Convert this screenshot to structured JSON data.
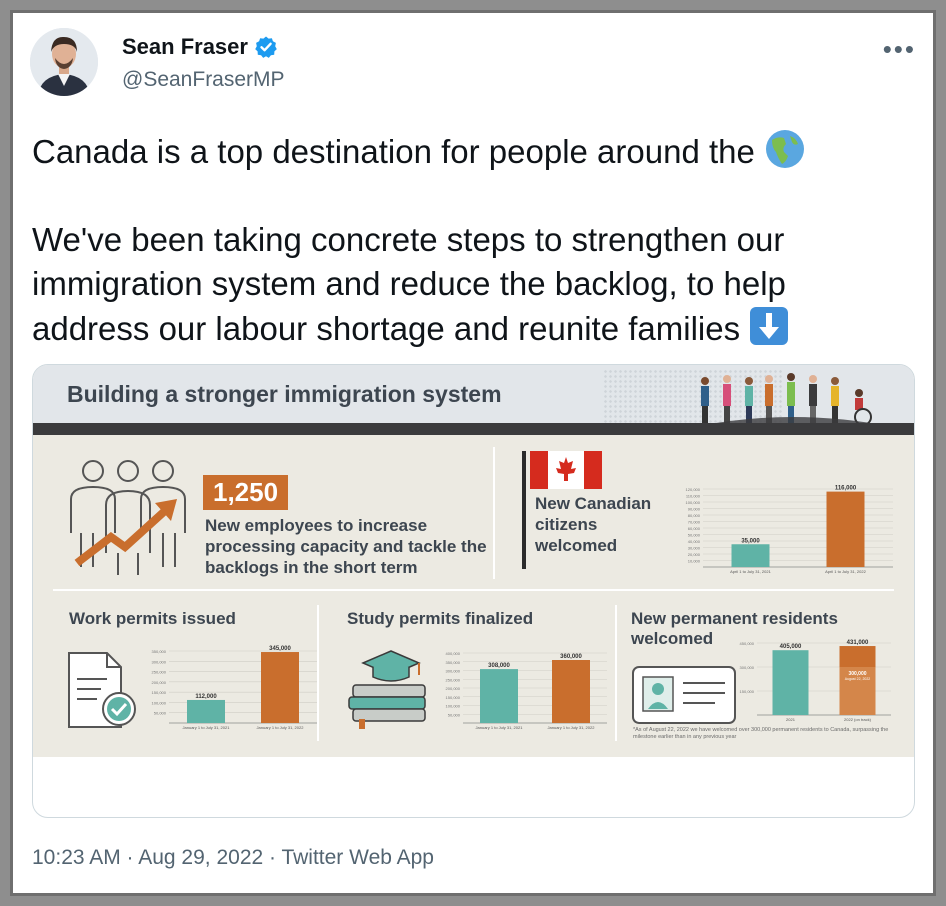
{
  "tweet": {
    "author_name": "Sean Fraser",
    "handle": "@SeanFraserMP",
    "more_label": "•••",
    "line1": "Canada is a top destination for people around the",
    "line2": "We've been taking concrete steps to strengthen our",
    "line3": "immigration system and reduce the backlog, to help",
    "line4": "address our labour shortage and reunite families",
    "timestamp": "10:23 AM · Aug 29, 2022 · Twitter Web App"
  },
  "infographic": {
    "title": "Building a stronger immigration system",
    "employees_number": "1,250",
    "employees_bold": "New employees",
    "employees_text": " to increase processing capacity and tackle the backlogs in the short term",
    "citizens_text": "New Canadian citizens welcomed",
    "work_title": "Work permits issued",
    "study_title": "Study permits finalized",
    "pr_title": "New permanent residents welcomed",
    "footnote": "*As of August 22, 2022 we have welcomed over 300,000 permanent residents to Canada, surpassing the milestone earlier than in any previous year"
  },
  "colors": {
    "teal": "#5fb3a6",
    "orange": "#c96e2d",
    "text_dark": "#3d4650",
    "verified_blue": "#1d9bf0"
  },
  "chart_data": [
    {
      "type": "bar",
      "title": "New Canadian citizens welcomed",
      "categories": [
        "April 1 to July 31, 2021",
        "April 1 to July 31, 2022"
      ],
      "values": [
        35000,
        116000
      ],
      "value_labels": [
        "35,000",
        "116,000"
      ],
      "ylim": [
        0,
        120000
      ],
      "yticks": [
        "120,000",
        "110,000",
        "100,000",
        "90,000",
        "80,000",
        "70,000",
        "60,000",
        "50,000",
        "40,000",
        "30,000",
        "20,000",
        "10,000"
      ],
      "colors": [
        "#5fb3a6",
        "#c96e2d"
      ]
    },
    {
      "type": "bar",
      "title": "Work permits issued",
      "categories": [
        "January 1 to July 31, 2021",
        "January 1 to July 31, 2022"
      ],
      "values": [
        112000,
        345000
      ],
      "value_labels": [
        "112,000",
        "345,000"
      ],
      "ylim": [
        0,
        350000
      ],
      "yticks": [
        "350,000",
        "300,000",
        "250,000",
        "200,000",
        "150,000",
        "100,000",
        "50,000"
      ],
      "colors": [
        "#5fb3a6",
        "#c96e2d"
      ]
    },
    {
      "type": "bar",
      "title": "Study permits finalized",
      "categories": [
        "January 1 to July 31, 2021",
        "January 1 to July 31, 2022"
      ],
      "values": [
        308000,
        360000
      ],
      "value_labels": [
        "308,000",
        "360,000"
      ],
      "ylim": [
        0,
        400000
      ],
      "yticks": [
        "400,000",
        "350,000",
        "300,000",
        "250,000",
        "200,000",
        "150,000",
        "100,000",
        "50,000"
      ],
      "colors": [
        "#5fb3a6",
        "#c96e2d"
      ]
    },
    {
      "type": "bar",
      "title": "New permanent residents welcomed",
      "categories": [
        "2021",
        "2022 (on track)"
      ],
      "values": [
        405000,
        431000
      ],
      "value_labels": [
        "405,000",
        "431,000"
      ],
      "overlay_label": "300,000",
      "overlay_sublabel": "August 22, 2022",
      "ylim": [
        0,
        450000
      ],
      "yticks": [
        "450,000",
        "300,000",
        "150,000"
      ],
      "colors": [
        "#5fb3a6",
        "#c96e2d"
      ]
    }
  ]
}
